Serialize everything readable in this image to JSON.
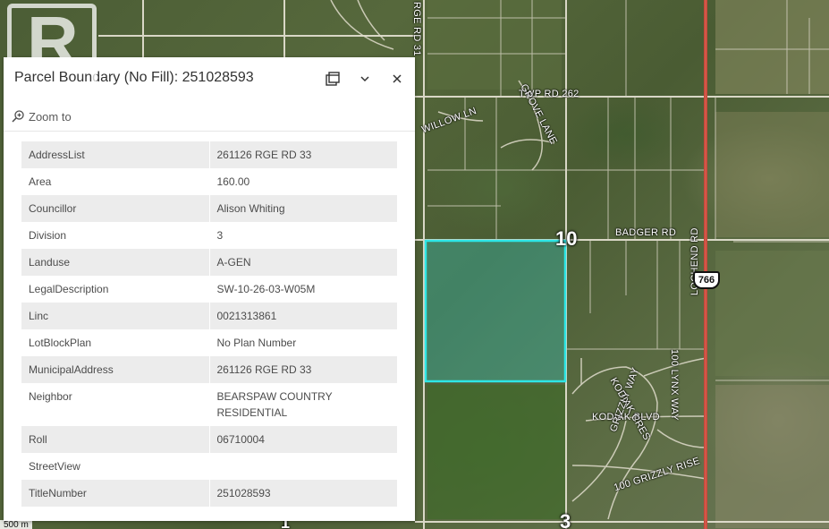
{
  "map": {
    "roads": [
      "TWP RD 262",
      "BADGER RD",
      "KODIAK BLVD",
      "GRIZZLY RISE",
      "RGE RD 31",
      "LOCHEND RD"
    ],
    "road_labels": {
      "twp_rd_262": "TWP RD 262",
      "badger_rd": "BADGER RD",
      "kodiak_blvd": "KODIAK BLVD",
      "kodiak_cres": "KODIAK CRES",
      "grizzly_rise": "100 GRIZZLY RISE",
      "grizzly_way": "GRIZZLY WAY",
      "lochend_rd": "LOCHEND RD",
      "rge_rd_31": "RGE RD 31",
      "grove_lane": "GROVE LANE",
      "willow_ln": "WILLOW LN",
      "lynx_way": "100 LYNX WAY"
    },
    "section_labels": {
      "section_10": "10",
      "section_3": "3",
      "section_1": "1"
    },
    "highway_shield": "766",
    "scale_text": "500 m",
    "parcel_color": "#2ee6e6",
    "highway_color": "#c9473a"
  },
  "watermark": {
    "brand": "REALTOR®",
    "letter": "R"
  },
  "popup": {
    "title": "Parcel Boundary (No Fill): 251028593",
    "zoom_label": "Zoom to",
    "icons": {
      "dock": "dock-icon",
      "collapse": "chevron-down-icon",
      "close": "close-icon",
      "zoom": "zoom-in-icon"
    },
    "attributes": [
      {
        "key": "AddressList",
        "value": "261126 RGE RD 33"
      },
      {
        "key": "Area",
        "value": "160.00"
      },
      {
        "key": "Councillor",
        "value": "Alison Whiting"
      },
      {
        "key": "Division",
        "value": "3"
      },
      {
        "key": "Landuse",
        "value": "A-GEN"
      },
      {
        "key": "LegalDescription",
        "value": "SW-10-26-03-W05M"
      },
      {
        "key": "Linc",
        "value": "0021313861"
      },
      {
        "key": "LotBlockPlan",
        "value": "No Plan Number"
      },
      {
        "key": "MunicipalAddress",
        "value": "261126 RGE RD 33"
      },
      {
        "key": "Neighbor",
        "value": "BEARSPAW COUNTRY RESIDENTIAL"
      },
      {
        "key": "Roll",
        "value": "06710004"
      },
      {
        "key": "StreetView",
        "value": ""
      },
      {
        "key": "TitleNumber",
        "value": "251028593"
      }
    ]
  }
}
